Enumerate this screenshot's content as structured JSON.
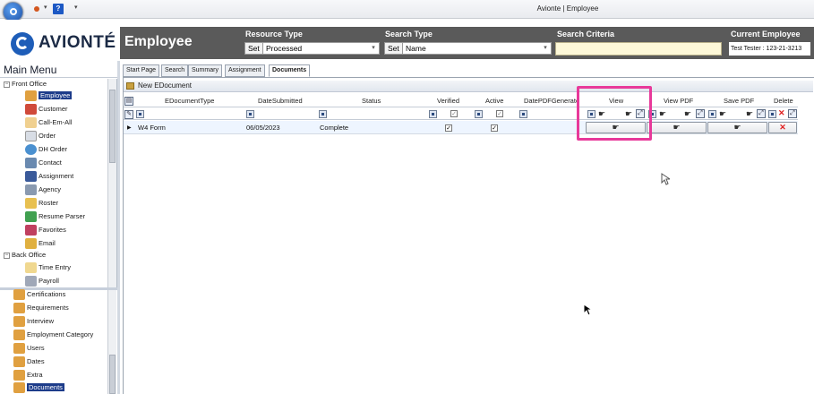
{
  "window": {
    "title": "Avionte | Employee",
    "help_icon": "?"
  },
  "brand": {
    "name": "AVIONTÉ"
  },
  "header": {
    "page_title": "Employee",
    "resource_type": {
      "label": "Resource Type",
      "set_label": "Set",
      "value": "Processed"
    },
    "search_type": {
      "label": "Search Type",
      "set_label": "Set",
      "value": "Name"
    },
    "search_criteria": {
      "label": "Search Criteria",
      "value": ""
    },
    "current_employee": {
      "label": "Current Employee",
      "value": "Test Tester : 123-21-3213"
    }
  },
  "main_menu": {
    "title": "Main Menu",
    "front_office": {
      "label": "Front Office",
      "items": [
        {
          "label": "Employee",
          "icon": "people-icon",
          "selected": true
        },
        {
          "label": "Customer",
          "icon": "handshake-icon"
        },
        {
          "label": "Call-Em-All",
          "icon": "phone-icon"
        },
        {
          "label": "Order",
          "icon": "document-icon"
        },
        {
          "label": "DH Order",
          "icon": "globe-icon"
        },
        {
          "label": "Contact",
          "icon": "contact-icon"
        },
        {
          "label": "Assignment",
          "icon": "assignment-icon"
        },
        {
          "label": "Agency",
          "icon": "agency-icon"
        },
        {
          "label": "Roster",
          "icon": "roster-icon"
        },
        {
          "label": "Resume Parser",
          "icon": "resume-icon"
        },
        {
          "label": "Favorites",
          "icon": "favorites-icon"
        },
        {
          "label": "Email",
          "icon": "email-icon"
        }
      ]
    },
    "back_office": {
      "label": "Back Office",
      "items": [
        {
          "label": "Time Entry",
          "icon": "clock-icon"
        },
        {
          "label": "Payroll",
          "icon": "payroll-icon"
        }
      ]
    },
    "sub_items": [
      {
        "label": "Certifications"
      },
      {
        "label": "Requirements"
      },
      {
        "label": "Interview"
      },
      {
        "label": "Employment Category"
      },
      {
        "label": "Users"
      },
      {
        "label": "Dates"
      },
      {
        "label": "Extra"
      },
      {
        "label": "Documents",
        "selected": true
      }
    ]
  },
  "tabs": [
    {
      "label": "Start Page"
    },
    {
      "label": "Search"
    },
    {
      "label": "Summary"
    },
    {
      "label": "Assignment"
    },
    {
      "label": "Documents",
      "active": true
    }
  ],
  "toolbar": {
    "new_document_label": "New EDocument"
  },
  "grid": {
    "columns": [
      "EDocumentType",
      "DateSubmitted",
      "Status",
      "Verified",
      "Active",
      "DatePDFGenerated",
      "View",
      "View PDF",
      "Save PDF",
      "Delete"
    ],
    "rows": [
      {
        "document_type": "W4 Form",
        "date_submitted": "06/05/2023",
        "status": "Complete",
        "verified": true,
        "active": true
      }
    ]
  },
  "colors": {
    "highlight": "#e8399a",
    "header_bar": "#5a5a5a",
    "selected": "#1d3c8a"
  }
}
